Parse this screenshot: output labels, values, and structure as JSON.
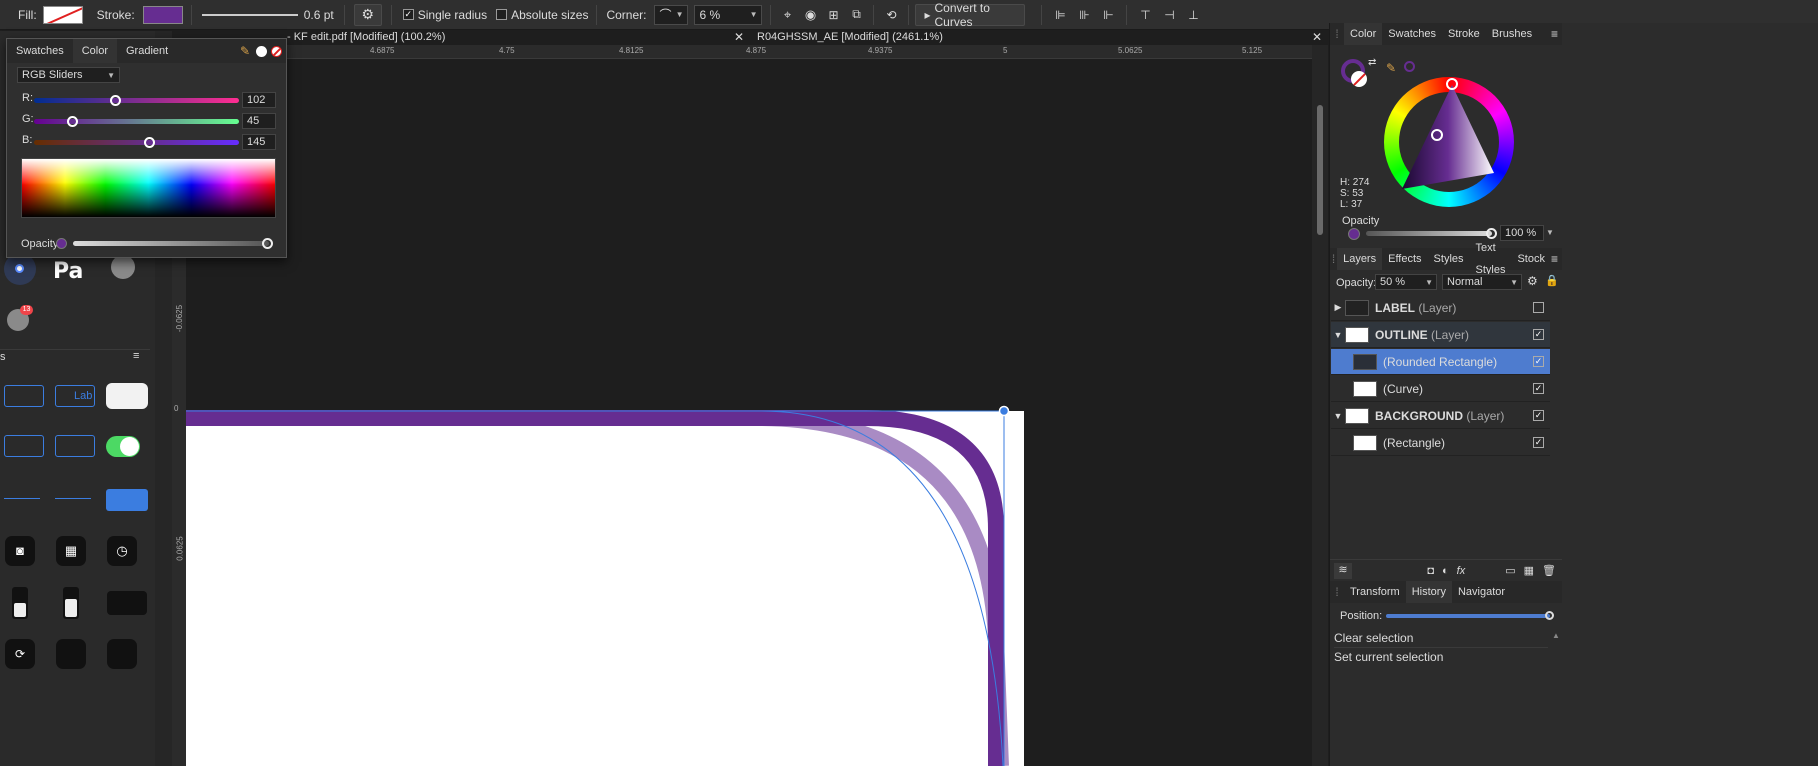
{
  "toolbar": {
    "fill_label": "Fill:",
    "stroke_label": "Stroke:",
    "stroke_width": "0.6 pt",
    "single_radius_label": "Single radius",
    "single_radius_checked": true,
    "absolute_sizes_label": "Absolute sizes",
    "absolute_sizes_checked": false,
    "corner_label": "Corner:",
    "corner_value": "6 %",
    "convert_button": "Convert to Curves",
    "stroke_color": "#662d91"
  },
  "color_popover": {
    "tabs": [
      "Swatches",
      "Color",
      "Gradient"
    ],
    "active_tab": "Color",
    "mode": "RGB Sliders",
    "r_label": "R:",
    "r_value": "102",
    "g_label": "G:",
    "g_value": "45",
    "b_label": "B:",
    "b_value": "145",
    "opacity_label": "Opacity"
  },
  "left_panel": {
    "symbol_text": "Pa",
    "badge_count": "13",
    "label_text": "Lab"
  },
  "doc_tabs": [
    {
      "title": "- KF edit.pdf [Modified] (100.2%)"
    },
    {
      "title": "R04GHSSM_AE [Modified] (2461.1%)"
    }
  ],
  "ruler": {
    "top_ticks": [
      "4.6875",
      "4.75",
      "4.8125",
      "4.875",
      "4.9375",
      "5",
      "5.0625",
      "5.125"
    ],
    "left_ticks": [
      "-0.0625",
      "0",
      "0.0625"
    ]
  },
  "right_panel": {
    "color_tabs": [
      "Color",
      "Swatches",
      "Stroke",
      "Brushes"
    ],
    "hsl": {
      "h": "H: 274",
      "s": "S: 53",
      "l": "L: 37"
    },
    "opacity_label": "Opacity",
    "opacity_value": "100 %",
    "layer_tabs": [
      "Layers",
      "Effects",
      "Styles",
      "Text Styles",
      "Stock"
    ],
    "layer_opacity_label": "Opacity:",
    "layer_opacity_value": "50 %",
    "blend_mode": "Normal",
    "layers": [
      {
        "name": "LABEL",
        "type": "(Layer)",
        "checked": false
      },
      {
        "name": "OUTLINE",
        "type": "(Layer)",
        "checked": true
      },
      {
        "name": "",
        "type": "(Rounded Rectangle)",
        "checked": true
      },
      {
        "name": "",
        "type": "(Curve)",
        "checked": true
      },
      {
        "name": "BACKGROUND",
        "type": "(Layer)",
        "checked": true
      },
      {
        "name": "",
        "type": "(Rectangle)",
        "checked": true
      }
    ],
    "bottom_tabs": [
      "Transform",
      "History",
      "Navigator"
    ],
    "position_label": "Position:",
    "history": [
      "Clear selection",
      "Set current selection"
    ]
  }
}
